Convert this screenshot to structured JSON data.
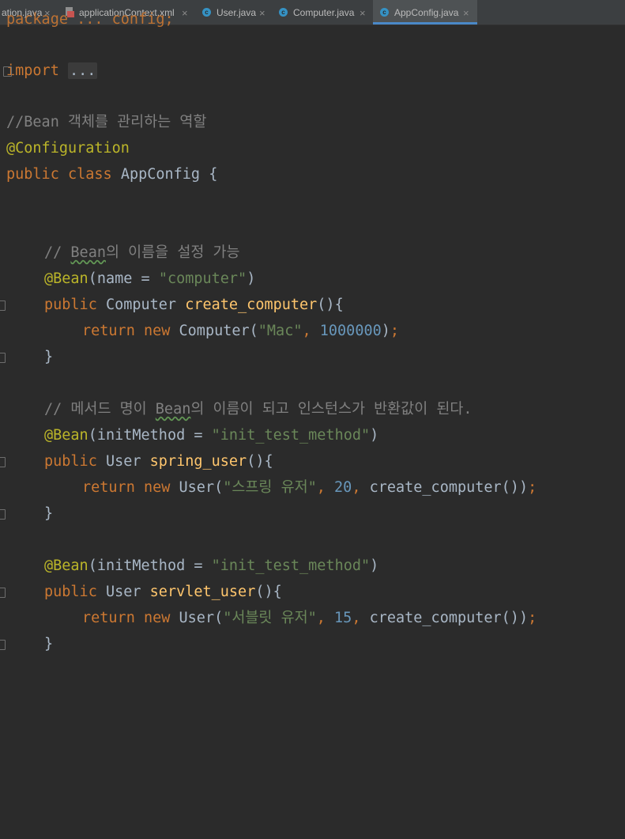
{
  "tabs": [
    {
      "label": "ation.java",
      "icon": "java-file-icon"
    },
    {
      "label": "applicationContext.xml",
      "icon": "xml-file-icon"
    },
    {
      "label": "User.java",
      "icon": "class-icon"
    },
    {
      "label": "Computer.java",
      "icon": "class-icon"
    },
    {
      "label": "AppConfig.java",
      "icon": "class-icon",
      "active": true
    }
  ],
  "close_glyph": "×",
  "class_icon_letter": "c",
  "code": {
    "top_partial": "package ... config;",
    "import_kw": "import",
    "import_fold": "...",
    "comment_class": "//Bean 객체를 관리하는 역할",
    "annotation_config": "@Configuration",
    "kw_public": "public",
    "kw_class": "class",
    "class_name": "AppConfig",
    "open_brace": "{",
    "comment1_prefix": "// ",
    "bean_word": "Bean",
    "comment1_rest": "의 이름을 설정 가능",
    "bean_ann": "@Bean",
    "name_attr": "(name = ",
    "str_computer": "\"computer\"",
    "close_paren": ")",
    "type_computer": "Computer",
    "fn_create_computer": "create_computer",
    "parens_brace": "(){",
    "kw_return": "return",
    "kw_new": "new",
    "ctor_computer_open": "Computer(",
    "str_mac": "\"Mac\"",
    "comma": ", ",
    "num_1000000": "1000000",
    "end_stmt": ");",
    "close_brace": "}",
    "comment2_prefix": "// 메서드 명이 ",
    "comment2_rest": "의 이름이 되고 인스턴스가 반환값이 된다.",
    "init_attr": "(initMethod = ",
    "str_init": "\"init_test_method\"",
    "type_user": "User",
    "fn_spring_user": "spring_user",
    "ctor_user_open": "User(",
    "str_spring_user": "\"스프링 유저\"",
    "num_20": "20",
    "call_create_computer": "create_computer()",
    "fn_servlet_user": "servlet_user",
    "str_servlet_user": "\"서블릿 유저\"",
    "num_15": "15"
  }
}
